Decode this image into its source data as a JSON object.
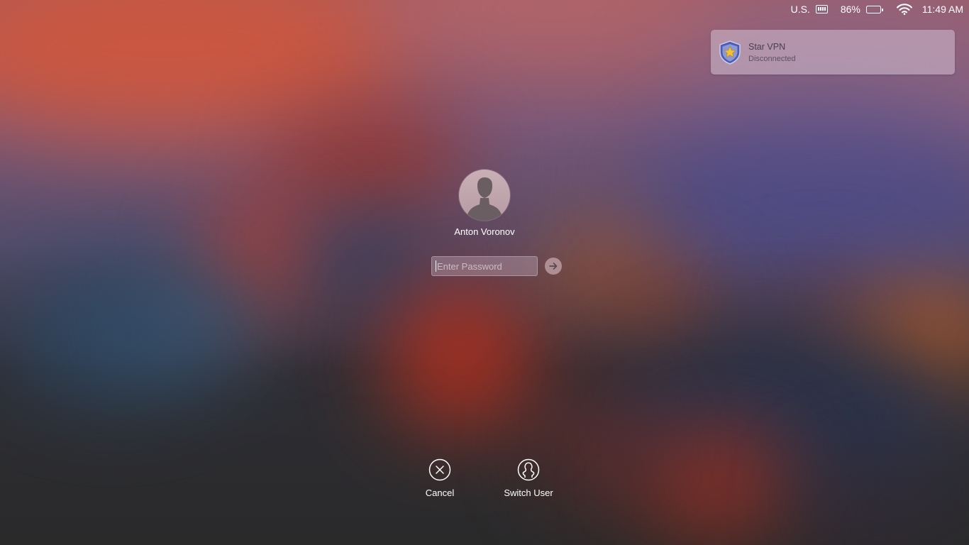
{
  "menubar": {
    "input_source": "U.S.",
    "input_source_icon": "keyboard-icon",
    "battery_percent_label": "86%",
    "battery_level": 0.86,
    "wifi_icon": "wifi-icon",
    "clock": "11:49 AM"
  },
  "notification": {
    "icon": "star-vpn-shield-icon",
    "title": "Star VPN",
    "subtitle": "Disconnected"
  },
  "login": {
    "avatar_icon": "user-silhouette-icon",
    "user_name": "Anton Voronov",
    "password_placeholder": "Enter Password",
    "password_value": "",
    "submit_icon": "arrow-right-icon"
  },
  "actions": {
    "cancel_label": "Cancel",
    "cancel_icon": "close-circle-icon",
    "switch_user_label": "Switch User",
    "switch_user_icon": "user-circle-icon"
  },
  "colors": {
    "text": "#ffffff",
    "notification_bg": "#d4c0d2",
    "background_dark": "#2a2a2b"
  }
}
